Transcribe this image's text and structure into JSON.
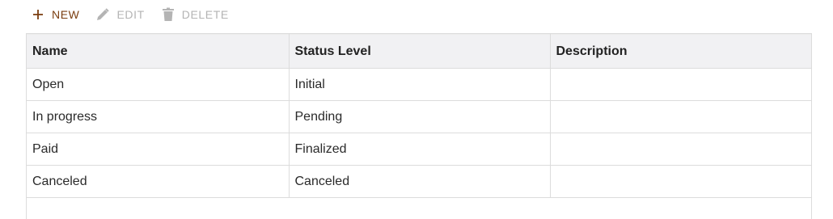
{
  "toolbar": {
    "new_label": "NEW",
    "edit_label": "EDIT",
    "delete_label": "DELETE",
    "accent_color": "#7a3d0f",
    "disabled_color": "#b4b4b4"
  },
  "table": {
    "columns": [
      "Name",
      "Status Level",
      "Description"
    ],
    "rows": [
      [
        "Open",
        "Initial",
        ""
      ],
      [
        "In progress",
        "Pending",
        ""
      ],
      [
        "Paid",
        "Finalized",
        ""
      ],
      [
        "Canceled",
        "Canceled",
        ""
      ]
    ]
  }
}
